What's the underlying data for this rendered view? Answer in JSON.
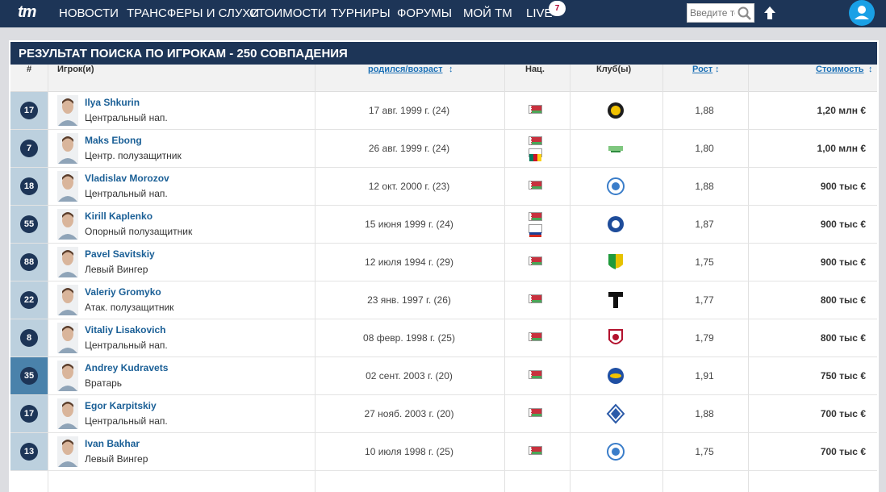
{
  "nav": {
    "logo": "tm",
    "items": [
      "НОВОСТИ",
      "ТРАНСФЕРЫ И СЛУХИ",
      "СТОИМОСТИ",
      "ТУРНИРЫ",
      "ФОРУМЫ",
      "МОЙ TM",
      "LIVE"
    ],
    "live_count": "7",
    "search_placeholder": "Введите текст поиска"
  },
  "results": {
    "title": "РЕЗУЛЬТАТ ПОИСКА ПО ИГРОКАМ - 250 СОВПАДЕНИЯ",
    "columns": {
      "number": "#",
      "player": "Игрок(и)",
      "born": "родился/возраст",
      "nation": "Нац.",
      "club": "Клуб(ы)",
      "height": "Рост",
      "value": "Стоимость"
    },
    "rows": [
      {
        "number": "17",
        "name": "Ilya Shkurin",
        "position": "Центральный нап.",
        "born": "17 авг. 1999 г. (24)",
        "flags": [
          "Belarus"
        ],
        "height": "1,88",
        "value": "1,20 млн €",
        "club_icon": "club-crest-icon"
      },
      {
        "number": "7",
        "name": "Maks Ebong",
        "position": "Центр. полузащитник",
        "born": "26 авг. 1999 г. (24)",
        "flags": [
          "Belarus",
          "Cameroon"
        ],
        "height": "1,80",
        "value": "1,00 млн €",
        "club_icon": "club-crest-icon"
      },
      {
        "number": "18",
        "name": "Vladislav Morozov",
        "position": "Центральный нап.",
        "born": "12 окт. 2000 г. (23)",
        "flags": [
          "Belarus"
        ],
        "height": "1,88",
        "value": "900 тыс €",
        "club_icon": "club-crest-icon"
      },
      {
        "number": "55",
        "name": "Kirill Kaplenko",
        "position": "Опорный полузащитник",
        "born": "15 июня 1999 г. (24)",
        "flags": [
          "Belarus",
          "Russia"
        ],
        "height": "1,87",
        "value": "900 тыс €",
        "club_icon": "club-crest-icon"
      },
      {
        "number": "88",
        "name": "Pavel Savitskiy",
        "position": "Левый Вингер",
        "born": "12 июля 1994 г. (29)",
        "flags": [
          "Belarus"
        ],
        "height": "1,75",
        "value": "900 тыс €",
        "club_icon": "club-crest-icon"
      },
      {
        "number": "22",
        "name": "Valeriy Gromyko",
        "position": "Атак. полузащитник",
        "born": "23 янв. 1997 г. (26)",
        "flags": [
          "Belarus"
        ],
        "height": "1,77",
        "value": "800 тыс €",
        "club_icon": "club-crest-icon"
      },
      {
        "number": "8",
        "name": "Vitaliy Lisakovich",
        "position": "Центральный нап.",
        "born": "08 февр. 1998 г. (25)",
        "flags": [
          "Belarus"
        ],
        "height": "1,79",
        "value": "800 тыс €",
        "club_icon": "club-crest-icon"
      },
      {
        "number": "35",
        "name": "Andrey Kudravets",
        "position": "Вратарь",
        "born": "02 сент. 2003 г. (20)",
        "flags": [
          "Belarus"
        ],
        "height": "1,91",
        "value": "750 тыс €",
        "club_icon": "club-crest-icon"
      },
      {
        "number": "17",
        "name": "Egor Karpitskiy",
        "position": "Центральный нап.",
        "born": "27 нояб. 2003 г. (20)",
        "flags": [
          "Belarus"
        ],
        "height": "1,88",
        "value": "700 тыс €",
        "club_icon": "club-crest-icon"
      },
      {
        "number": "13",
        "name": "Ivan Bakhar",
        "position": "Левый Вингер",
        "born": "10 июля 1998 г. (25)",
        "flags": [
          "Belarus"
        ],
        "height": "1,75",
        "value": "700 тыс €",
        "club_icon": "club-crest-icon"
      }
    ]
  },
  "colors": {
    "nav_bg": "#1d3557",
    "link": "#1a5f96",
    "number_cell": "#bcd0de",
    "number_cell_goalkeeper": "#4a82ab",
    "user_avatar": "#19a0e6"
  }
}
